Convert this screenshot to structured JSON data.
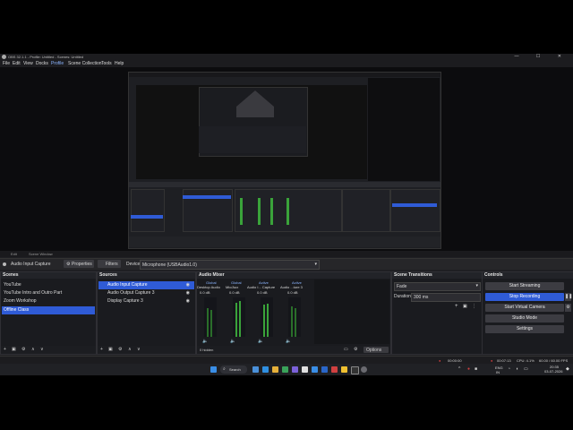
{
  "window": {
    "title": "OBS 32.1.1 - Profile: Untitled - Scenes: Untitled",
    "controls": "— ☐ ✕"
  },
  "menu": [
    "File",
    "Edit",
    "View",
    "Docks",
    "Profile",
    "Scene Collection",
    "Tools",
    "Help"
  ],
  "preview_tabs": [
    "Edit",
    "Scene Window"
  ],
  "source_bar": {
    "selected_source": "Audio Input Capture",
    "properties": "Properties",
    "filters": "Filters",
    "device_label": "Device",
    "device_value": "Microphone (USBAudio1.0)"
  },
  "scenes": {
    "title": "Scenes",
    "items": [
      "YouTube",
      "YouTube Intro and Outro Part",
      "Zoom Workshop",
      "Offline Class"
    ],
    "selected_index": 3
  },
  "sources": {
    "title": "Sources",
    "items": [
      "Audio Input Capture",
      "Audio Output Capture 3",
      "Display Capture 3"
    ],
    "selected_index": 0
  },
  "audio_mixer": {
    "title": "Audio Mixer",
    "groups": [
      "Global",
      "Global",
      "Active",
      "Active"
    ],
    "channels": [
      "Desktop Audio",
      "Mic/Aux",
      "Audio I... Capture",
      "Audio ...ture 3"
    ],
    "db": [
      "0.0 dB",
      "0.0 dB",
      "0.0 dB",
      "0.0 dB"
    ],
    "hidden_label": "0 hidden",
    "options": "Options"
  },
  "transitions": {
    "title": "Scene Transitions",
    "type": "Fade",
    "duration_label": "Duration",
    "duration_value": "300 ms"
  },
  "controls": {
    "title": "Controls",
    "start_streaming": "Start Streaming",
    "stop_recording": "Stop Recording",
    "start_virtual_camera": "Start Virtual Camera",
    "studio_mode": "Studio Mode",
    "settings": "Settings"
  },
  "status": {
    "stream_time": "00:00:00",
    "rec_time": "00:07:13",
    "cpu": "CPU: 4.1%",
    "fps": "60.00 / 60.00 FPS"
  },
  "taskbar": {
    "search": "Search",
    "lang": "ENG",
    "region": "IN",
    "time": "20:35",
    "date": "03-07-2026"
  },
  "colors": {
    "accent": "#2f5bd6",
    "recording": "#d04040",
    "meter_green": "#3aa33a"
  }
}
